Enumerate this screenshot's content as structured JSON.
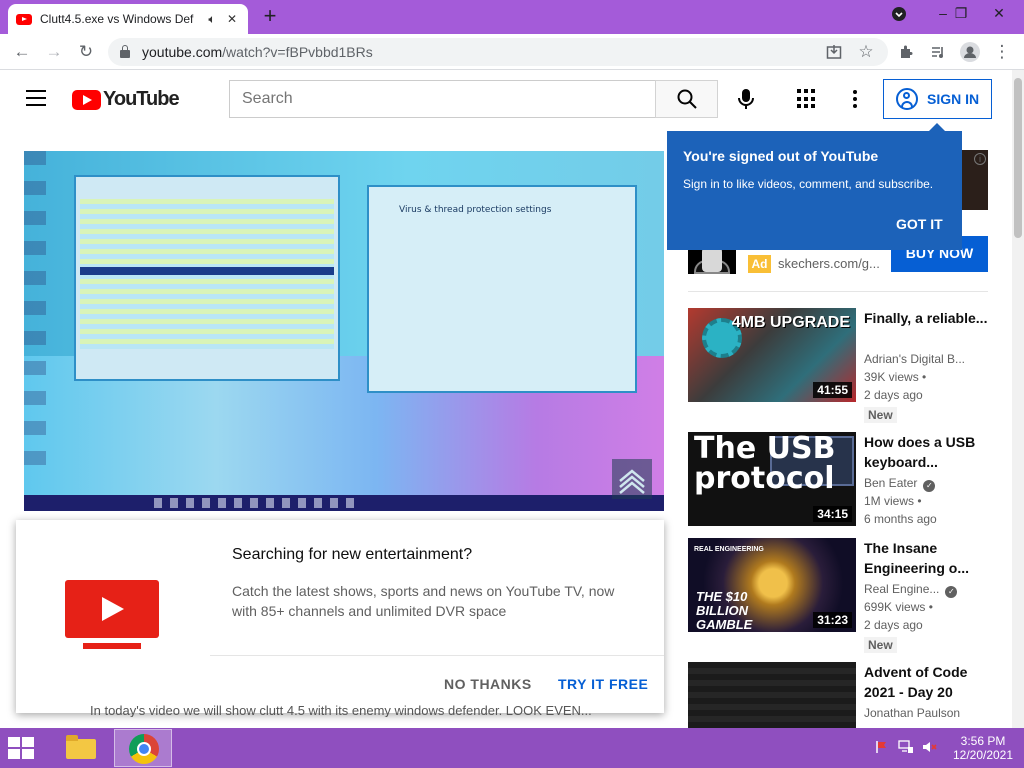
{
  "browser": {
    "tab_title": "Clutt4.5.exe vs Windows Def",
    "url_host": "youtube.com",
    "url_path": "/watch?v=fBPvbbd1BRs"
  },
  "youtube": {
    "logo_text": "YouTube",
    "search_placeholder": "Search",
    "sign_in_label": "SIGN IN"
  },
  "tooltip": {
    "title": "You're signed out of YouTube",
    "body": "Sign in to like videos, comment, and subscribe.",
    "button": "GOT IT"
  },
  "ad": {
    "badge": "Ad",
    "domain": "skechers.com/g...",
    "cta": "BUY NOW"
  },
  "promo": {
    "title": "Searching for new entertainment?",
    "body": "Catch the latest shows, sports and news on YouTube TV, now with 85+ channels and unlimited DVR space",
    "no_thanks": "NO THANKS",
    "try_free": "TRY IT FREE"
  },
  "description_peek": "In today's video we will show clutt 4.5 with its enemy windows defender. LOOK EVEN...",
  "player": {
    "window_heading": "Virus & thread protection settings"
  },
  "recommendations": [
    {
      "title": "Finally, a reliable...",
      "channel": "Adrian's Digital B...",
      "verified": false,
      "views": "39K views •",
      "age": "2 days ago",
      "badge": "New",
      "duration": "41:55",
      "thumb_text": "4MB UPGRADE"
    },
    {
      "title": "How does a USB keyboard...",
      "channel": "Ben Eater",
      "verified": true,
      "views": "1M views •",
      "age": "6 months ago",
      "badge": "",
      "duration": "34:15",
      "thumb_text": "The USB protocol"
    },
    {
      "title": "The Insane Engineering o...",
      "channel": "Real Engine...",
      "verified": true,
      "views": "699K views •",
      "age": "2 days ago",
      "badge": "New",
      "duration": "31:23",
      "thumb_text": "THE $10 BILLION GAMBLE",
      "thumb_small": "REAL ENGINEERING"
    },
    {
      "title": "Advent of Code 2021 - Day 20",
      "channel": "Jonathan Paulson",
      "verified": false,
      "views": "",
      "age": "",
      "badge": "",
      "duration": ""
    }
  ],
  "taskbar": {
    "time": "3:56 PM",
    "date": "12/20/2021"
  },
  "colors": {
    "tabstrip": "#a45bd9",
    "taskbar": "#8f4fbf",
    "youtube_red": "#ff0000",
    "link_blue": "#065fd4",
    "tooltip_blue": "#1c62b9"
  }
}
